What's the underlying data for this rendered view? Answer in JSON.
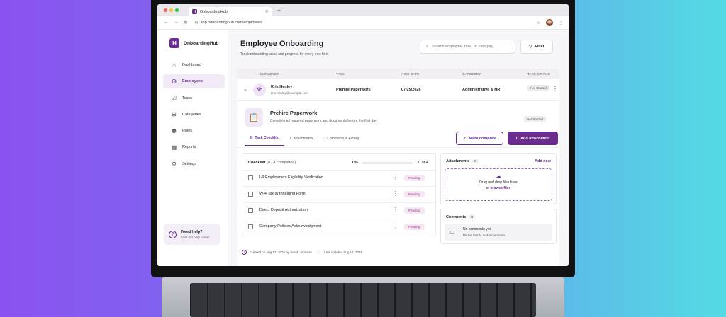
{
  "browser": {
    "tab_title": "OnboardingHub",
    "tab_favicon": "H",
    "url": "app.onboardinghub.com/employees",
    "traffic_lights": [
      "#ff5f57",
      "#febc2e",
      "#28c840"
    ]
  },
  "sidebar": {
    "logo_letter": "H",
    "brand": "OnboardingHub",
    "items": [
      {
        "label": "Dashboard",
        "icon": "home-icon"
      },
      {
        "label": "Employees",
        "icon": "user-icon",
        "active": true
      },
      {
        "label": "Tasks",
        "icon": "check-square-icon"
      },
      {
        "label": "Categories",
        "icon": "grid-icon"
      },
      {
        "label": "Roles",
        "icon": "users-icon"
      },
      {
        "label": "Reports",
        "icon": "chart-icon"
      },
      {
        "label": "Settings",
        "icon": "gear-icon"
      }
    ],
    "help": {
      "title": "Need help?",
      "subtitle": "Visit our help center"
    }
  },
  "header": {
    "title": "Employee Onboarding",
    "subtitle": "Track onboarding tasks and progress for every new hire.",
    "search_placeholder": "Search employee, task, or category...",
    "filter_label": "Filter"
  },
  "table": {
    "columns": [
      "EMPLOYEE",
      "TASK",
      "HIRE DATE",
      "CATEGORY",
      "TASK STATUS"
    ],
    "row": {
      "initials": "KH",
      "name": "Kris Henley",
      "email": "kris.henley@example.com",
      "task": "Prehire Paperwork",
      "hire_date": "07/29/2026",
      "category": "Administrative & HR",
      "status": "Not Started"
    }
  },
  "detail": {
    "title": "Prehire Paperwork",
    "description": "Complete all required paperwork and documents before the first day.",
    "status": "Not Started",
    "tabs": [
      "Task Checklist",
      "Attachments",
      "Comments & Activity"
    ],
    "mark_complete": "Mark complete",
    "add_attachment": "Add attachment",
    "checklist": {
      "title": "Checklist",
      "summary": "(0 / 4 completed)",
      "percent": "0%",
      "progress": 0,
      "count": "0 of 4",
      "items": [
        {
          "label": "I-9 Employment Eligibility Verification",
          "status": "Pending"
        },
        {
          "label": "W-4 Tax Withholding Form",
          "status": "Pending"
        },
        {
          "label": "Direct Deposit Authorization",
          "status": "Pending"
        },
        {
          "label": "Company Policies Acknowledgment",
          "status": "Pending"
        }
      ]
    },
    "attachments": {
      "title": "Attachments",
      "count": "0",
      "add_new": "Add new",
      "drop_text": "Drag and drop files here",
      "or_text": "or",
      "browse": "browse files"
    },
    "comments": {
      "title": "Comments",
      "count": "0",
      "empty_title": "No comments yet",
      "empty_sub": "Be the first to add a comment."
    },
    "created": "Created on Aug 12, 2025 by Sarah Johnson",
    "updated": "Last updated Aug 12, 2025"
  }
}
